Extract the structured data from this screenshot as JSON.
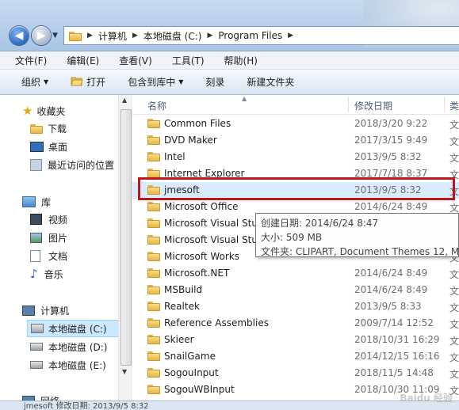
{
  "window": {
    "address": {
      "crumbs": [
        "计算机",
        "本地磁盘 (C:)",
        "Program Files"
      ]
    }
  },
  "menu": [
    "文件(F)",
    "编辑(E)",
    "查看(V)",
    "工具(T)",
    "帮助(H)"
  ],
  "toolbar": {
    "organize": "组织",
    "open": "打开",
    "include_library": "包含到库中",
    "burn": "刻录",
    "new_folder": "新建文件夹"
  },
  "nav": {
    "favorites": "收藏夹",
    "downloads": "下载",
    "desktop": "桌面",
    "recent": "最近访问的位置",
    "libraries": "库",
    "videos": "视频",
    "pictures": "图片",
    "documents": "文档",
    "music": "音乐",
    "computer": "计算机",
    "drive_c": "本地磁盘 (C:)",
    "drive_d": "本地磁盘 (D:)",
    "drive_e": "本地磁盘 (E:)",
    "network": "网络"
  },
  "columns": {
    "name": "名称",
    "date": "修改日期",
    "type": "类"
  },
  "files": [
    {
      "name": "Common Files",
      "date": "2018/3/20 9:22",
      "type": "文"
    },
    {
      "name": "DVD Maker",
      "date": "2017/3/15 9:49",
      "type": "文"
    },
    {
      "name": "Intel",
      "date": "2013/9/5 8:32",
      "type": "文"
    },
    {
      "name": "Internet Explorer",
      "date": "2017/7/18 8:37",
      "type": "文"
    },
    {
      "name": "jmesoft",
      "date": "2013/9/5 8:32",
      "type": "文"
    },
    {
      "name": "Microsoft Office",
      "date": "2014/6/24 8:49",
      "type": "文"
    },
    {
      "name": "Microsoft Visual Stu",
      "date": "",
      "type": "文"
    },
    {
      "name": "Microsoft Visual Stu",
      "date": "",
      "type": "文"
    },
    {
      "name": "Microsoft Works",
      "date": "",
      "type": "文"
    },
    {
      "name": "Microsoft.NET",
      "date": "2014/6/24 8:49",
      "type": "文"
    },
    {
      "name": "MSBuild",
      "date": "2014/6/24 8:49",
      "type": "文"
    },
    {
      "name": "Realtek",
      "date": "2013/9/5 8:33",
      "type": "文"
    },
    {
      "name": "Reference Assemblies",
      "date": "2009/7/14 12:52",
      "type": "文"
    },
    {
      "name": "Skieer",
      "date": "2018/10/31 16:29",
      "type": "文"
    },
    {
      "name": "SnailGame",
      "date": "2014/12/15 16:16",
      "type": "文"
    },
    {
      "name": "SogouInput",
      "date": "2018/11/5 14:48",
      "type": "文"
    },
    {
      "name": "SogouWBInput",
      "date": "2018/10/30 11:09",
      "type": "文"
    }
  ],
  "tooltip": {
    "created": "创建日期: 2014/6/24 8:47",
    "size": "大小: 509 MB",
    "folders": "文件夹: CLIPART, Document Themes 12, ME"
  },
  "status": "jmesoft  修改日期: 2013/9/5 8:32",
  "watermark": "Baidu 经验"
}
